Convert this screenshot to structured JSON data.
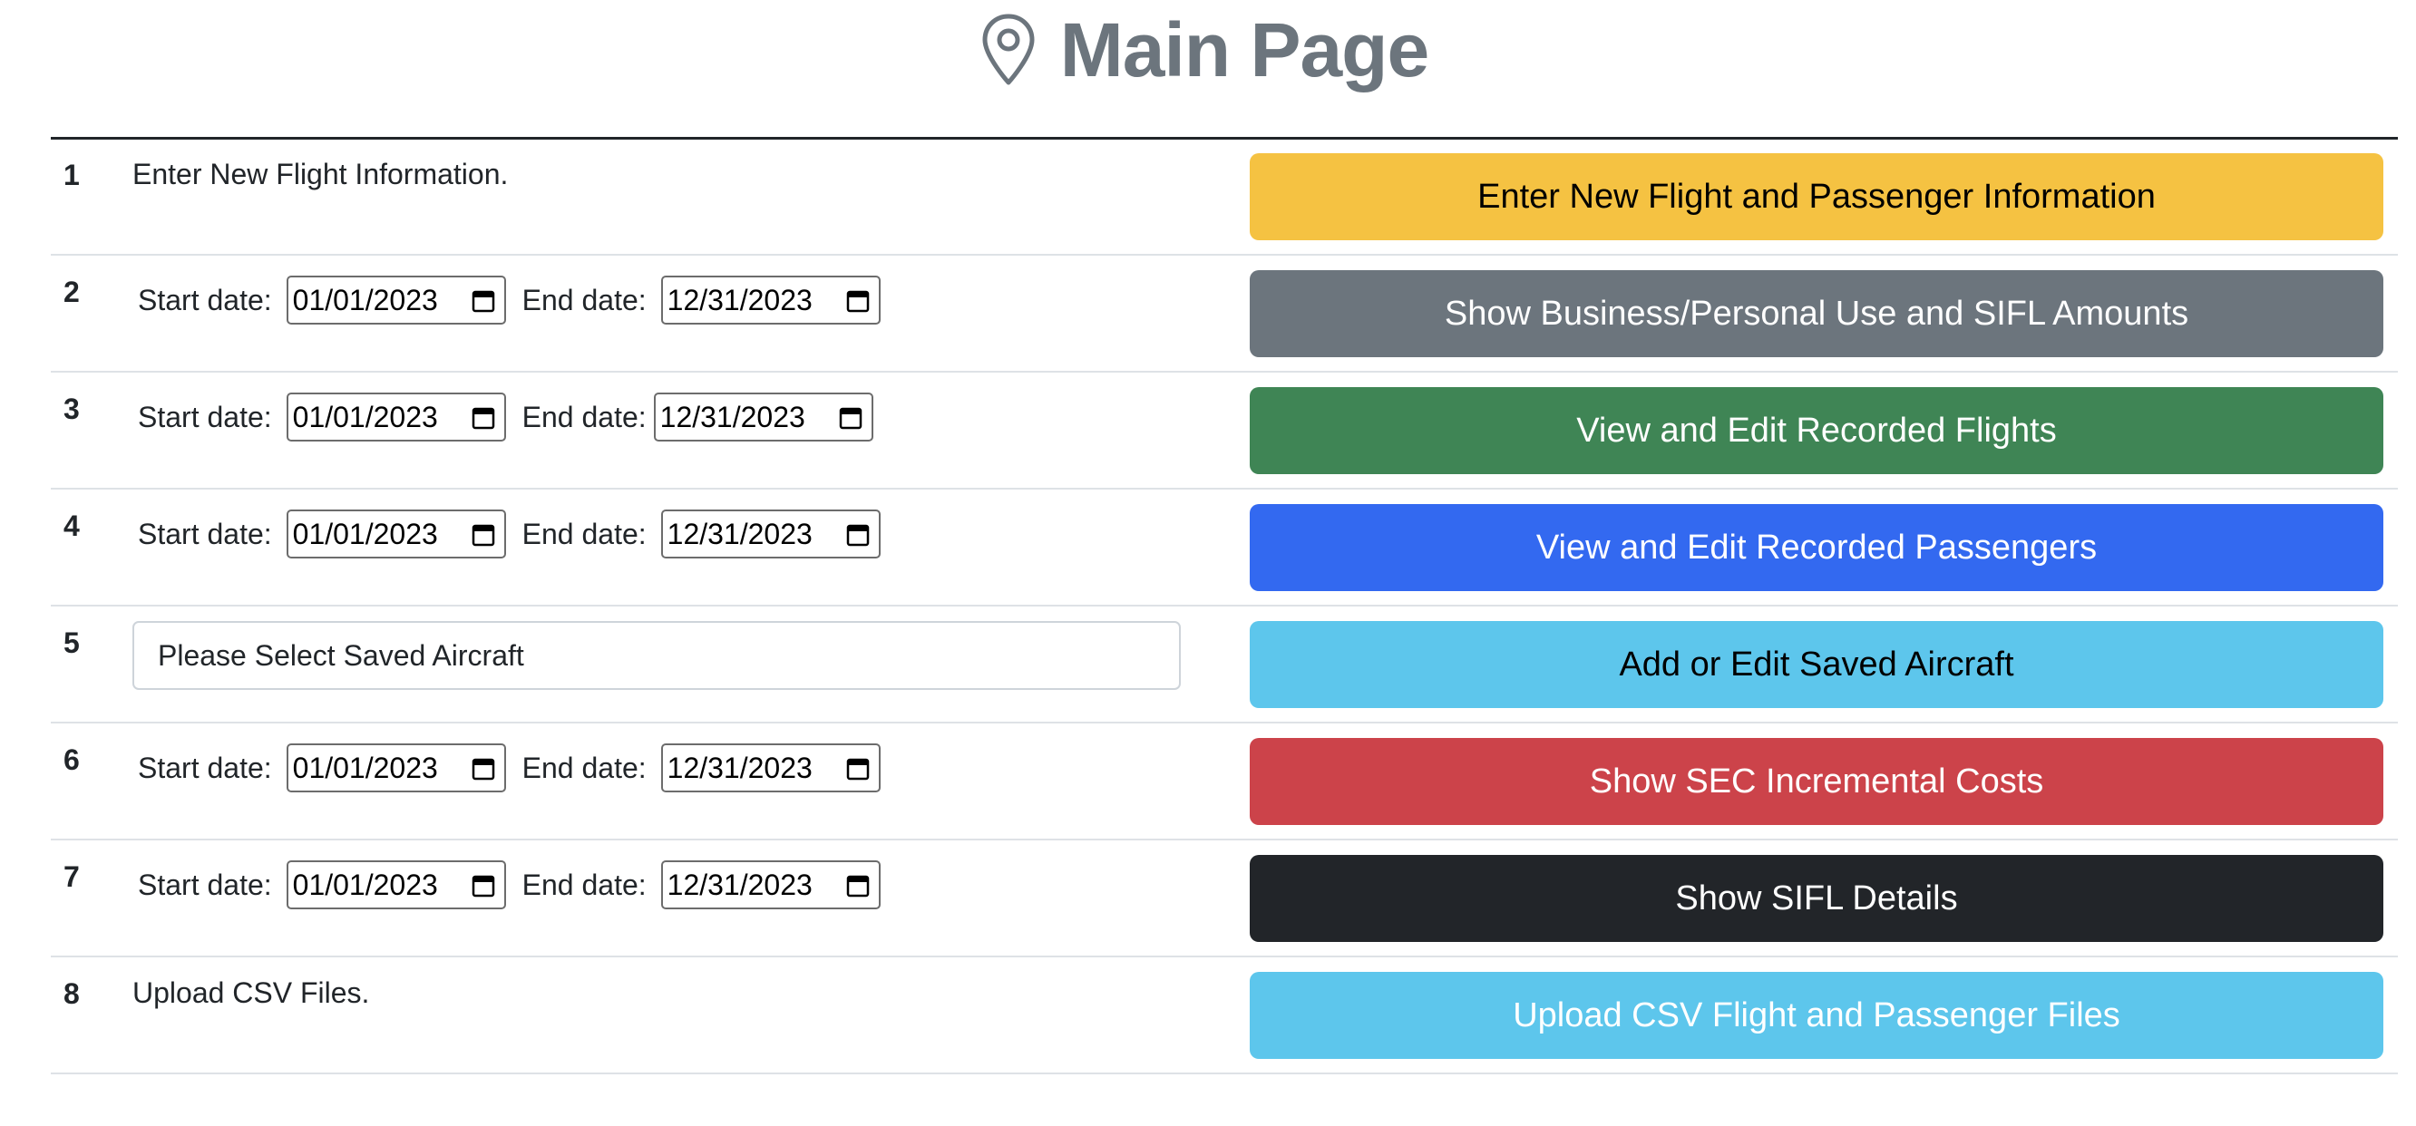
{
  "page": {
    "title": "Main Page",
    "title_icon": "map-pin-icon"
  },
  "rows": [
    {
      "num": "1",
      "text": "Enter New Flight Information.",
      "button": {
        "label": "Enter New Flight and Passenger Information",
        "bg": "#f5c242",
        "fg": "#000000"
      }
    },
    {
      "num": "2",
      "start_label": "Start date:",
      "start_value": "01/01/2023",
      "end_label": "End date:",
      "end_value": "12/31/2023",
      "button": {
        "label": "Show Business/Personal Use and SIFL Amounts",
        "bg": "#6c757d",
        "fg": "#ffffff"
      }
    },
    {
      "num": "3",
      "start_label": "Start date:",
      "start_value": "01/01/2023",
      "end_label": "End date:",
      "end_value": "12/31/2023",
      "button": {
        "label": "View and Edit Recorded Flights",
        "bg": "#3f8555",
        "fg": "#ffffff"
      }
    },
    {
      "num": "4",
      "start_label": "Start date:",
      "start_value": "01/01/2023",
      "end_label": "End date:",
      "end_value": "12/31/2023",
      "button": {
        "label": "View and Edit Recorded Passengers",
        "bg": "#3369f0",
        "fg": "#ffffff"
      }
    },
    {
      "num": "5",
      "select_value": "Please Select Saved Aircraft",
      "button": {
        "label": "Add or Edit Saved Aircraft",
        "bg": "#5dc6ec",
        "fg": "#000000"
      }
    },
    {
      "num": "6",
      "start_label": "Start date:",
      "start_value": "01/01/2023",
      "end_label": "End date:",
      "end_value": "12/31/2023",
      "button": {
        "label": "Show SEC Incremental Costs",
        "bg": "#cc434a",
        "fg": "#ffffff"
      }
    },
    {
      "num": "7",
      "start_label": "Start date:",
      "start_value": "01/01/2023",
      "end_label": "End date:",
      "end_value": "12/31/2023",
      "button": {
        "label": "Show SIFL Details",
        "bg": "#222529",
        "fg": "#ffffff"
      }
    },
    {
      "num": "8",
      "text": "Upload CSV Files.",
      "button": {
        "label": "Upload CSV Flight and Passenger Files",
        "bg": "#5dc6ec",
        "fg": "#ffffff"
      }
    }
  ]
}
